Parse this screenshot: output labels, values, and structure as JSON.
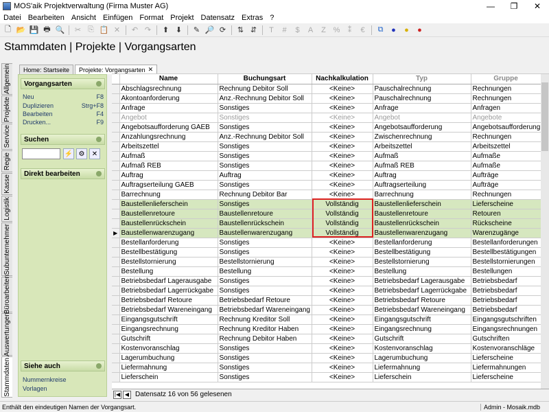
{
  "window": {
    "title": "MOS'aik Projektverwaltung (Firma Muster AG)"
  },
  "menu": [
    "Datei",
    "Bearbeiten",
    "Ansicht",
    "Einfügen",
    "Format",
    "Projekt",
    "Datensatz",
    "Extras",
    "?"
  ],
  "page_title": "Stammdaten | Projekte | Vorgangsarten",
  "vertical_tabs": [
    "Allgemein",
    "Projekte",
    "Service",
    "Regie",
    "Kasse",
    "Logistik",
    "Subunternehmer",
    "Büroarbeiten",
    "Auswertungen",
    "Stammdaten"
  ],
  "doc_tabs": [
    {
      "label": "Home: Startseite"
    },
    {
      "label": "Projekte: Vorgangsarten"
    }
  ],
  "nav": {
    "vorgangsarten": {
      "title": "Vorgangsarten",
      "items": [
        {
          "label": "Neu",
          "key": "F8"
        },
        {
          "label": "Duplizieren",
          "key": "Strg+F8"
        },
        {
          "label": "Bearbeiten",
          "key": "F4"
        },
        {
          "label": "Drucken...",
          "key": "F9"
        }
      ]
    },
    "suchen": {
      "title": "Suchen"
    },
    "direkt": {
      "title": "Direkt bearbeiten"
    },
    "siehe": {
      "title": "Siehe auch",
      "links": [
        "Nummernkreise",
        "Vorlagen"
      ]
    }
  },
  "grid": {
    "columns": [
      "Name",
      "Buchungsart",
      "Nachkalkulation",
      "Typ",
      "Gruppe"
    ],
    "rows": [
      [
        "Abschlagsrechnung",
        "Rechnung Debitor Soll",
        "<Keine>",
        "Pauschalrechnung",
        "Rechnungen"
      ],
      [
        "Akontoanforderung",
        "Anz.-Rechnung Debitor Soll",
        "<Keine>",
        "Pauschalrechnung",
        "Rechnungen"
      ],
      [
        "Anfrage",
        "Sonstiges",
        "<Keine>",
        "Anfrage",
        "Anfragen"
      ],
      [
        "Angebot",
        "Sonstiges",
        "<Keine>",
        "Angebot",
        "Angebote"
      ],
      [
        "Angebotsaufforderung GAEB",
        "Sonstiges",
        "<Keine>",
        "Angebotsaufforderung",
        "Angebotsaufforderung"
      ],
      [
        "Anzahlungsrechnung",
        "Anz.-Rechnung Debitor Soll",
        "<Keine>",
        "Zwischenrechnung",
        "Rechnungen"
      ],
      [
        "Arbeitszettel",
        "Sonstiges",
        "<Keine>",
        "Arbeitszettel",
        "Arbeitszettel"
      ],
      [
        "Aufmaß",
        "Sonstiges",
        "<Keine>",
        "Aufmaß",
        "Aufmaße"
      ],
      [
        "Aufmaß REB",
        "Sonstiges",
        "<Keine>",
        "Aufmaß REB",
        "Aufmaße"
      ],
      [
        "Auftrag",
        "Auftrag",
        "<Keine>",
        "Auftrag",
        "Aufträge"
      ],
      [
        "Auftragserteilung GAEB",
        "Sonstiges",
        "<Keine>",
        "Auftragserteilung",
        "Aufträge"
      ],
      [
        "Barrechnung",
        "Rechnung Debitor Bar",
        "<Keine>",
        "Barrechnung",
        "Rechnungen"
      ],
      [
        "Baustellenlieferschein",
        "Sonstiges",
        "Vollständig",
        "Baustellenlieferschein",
        "Lieferscheine"
      ],
      [
        "Baustellenretoure",
        "Baustellenretoure",
        "Vollständig",
        "Baustellenretoure",
        "Retouren"
      ],
      [
        "Baustellenrückschein",
        "Baustellenrückschein",
        "Vollständig",
        "Baustellenrückschein",
        "Rückscheine"
      ],
      [
        "Baustellenwarenzugang",
        "Baustellenwarenzugang",
        "Vollständig",
        "Baustellenwarenzugang",
        "Warenzugänge"
      ],
      [
        "Bestellanforderung",
        "Sonstiges",
        "<Keine>",
        "Bestellanforderung",
        "Bestellanforderungen"
      ],
      [
        "Bestellbestätigung",
        "Sonstiges",
        "<Keine>",
        "Bestellbestätigung",
        "Bestellbestätigungen"
      ],
      [
        "Bestellstornierung",
        "Bestellstornierung",
        "<Keine>",
        "Bestellstornierung",
        "Bestellstornierungen"
      ],
      [
        "Bestellung",
        "Bestellung",
        "<Keine>",
        "Bestellung",
        "Bestellungen"
      ],
      [
        "Betriebsbedarf Lagerausgabe",
        "Sonstiges",
        "<Keine>",
        "Betriebsbedarf Lagerausgabe",
        "Betriebsbedarf"
      ],
      [
        "Betriebsbedarf Lagerrückgabe",
        "Sonstiges",
        "<Keine>",
        "Betriebsbedarf Lagerrückgabe",
        "Betriebsbedarf"
      ],
      [
        "Betriebsbedarf Retoure",
        "Betriebsbedarf Retoure",
        "<Keine>",
        "Betriebsbedarf Retoure",
        "Betriebsbedarf"
      ],
      [
        "Betriebsbedarf Wareneingang",
        "Betriebsbedarf Wareneingang",
        "<Keine>",
        "Betriebsbedarf Wareneingang",
        "Betriebsbedarf"
      ],
      [
        "Eingangsgutschrift",
        "Rechnung Kreditor Soll",
        "<Keine>",
        "Eingangsgutschrift",
        "Eingangsgutschriften"
      ],
      [
        "Eingangsrechnung",
        "Rechnung Kreditor Haben",
        "<Keine>",
        "Eingangsrechnung",
        "Eingangsrechnungen"
      ],
      [
        "Gutschrift",
        "Rechnung Debitor Haben",
        "<Keine>",
        "Gutschrift",
        "Gutschriften"
      ],
      [
        "Kostenvoranschlag",
        "Sonstiges",
        "<Keine>",
        "Kostenvoranschlag",
        "Kostenvoranschläge"
      ],
      [
        "Lagerumbuchung",
        "Sonstiges",
        "<Keine>",
        "Lagerumbuchung",
        "Lieferscheine"
      ],
      [
        "Liefermahnung",
        "Sonstiges",
        "<Keine>",
        "Liefermahnung",
        "Liefermahnungen"
      ],
      [
        "Lieferschein",
        "Sonstiges",
        "<Keine>",
        "Lieferschein",
        "Lieferscheine"
      ]
    ]
  },
  "recnav": {
    "text": "Datensatz 16 von 56 gelesenen"
  },
  "status": {
    "message": "Enthält den eindeutigen Namen der Vorgangsart.",
    "user": "Admin - Mosaik.mdb"
  }
}
